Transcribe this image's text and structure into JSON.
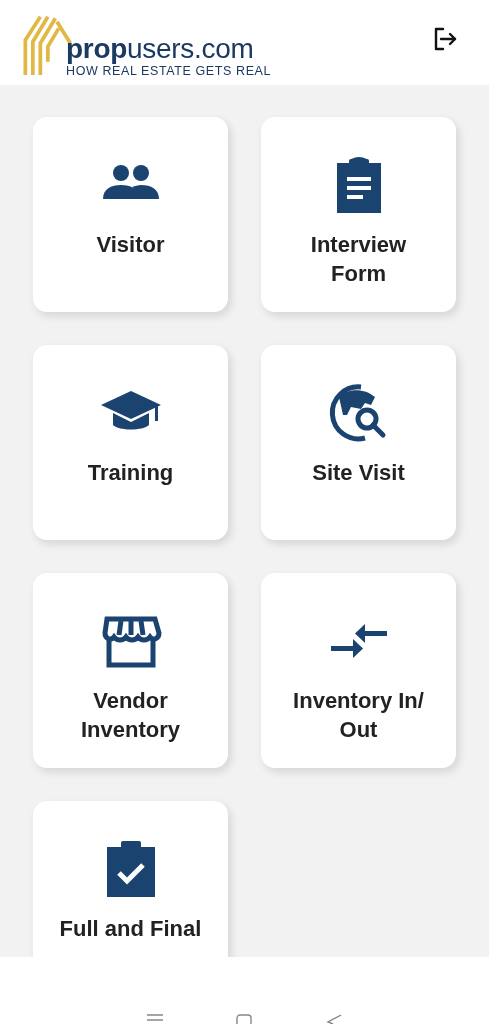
{
  "header": {
    "logo": {
      "name": "**prop**users.com",
      "tagline": "HOW REAL ESTATE GETS REAL"
    }
  },
  "tiles": [
    {
      "kind": "people",
      "label": "Visitor"
    },
    {
      "kind": "clipboard",
      "label": "Interview Form"
    },
    {
      "kind": "cap",
      "label": "Training"
    },
    {
      "kind": "globe",
      "label": "Site Visit"
    },
    {
      "kind": "store",
      "label": "Vendor Inventory"
    },
    {
      "kind": "arrows",
      "label": "Inventory In/ Out"
    },
    {
      "kind": "check",
      "label": "Full and Final"
    }
  ]
}
